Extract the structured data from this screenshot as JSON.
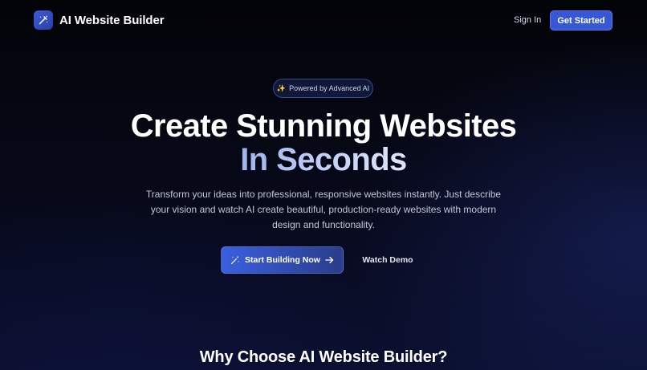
{
  "header": {
    "brand_name": "AI Website Builder",
    "logo_icon": "magic-wand-icon",
    "sign_in": "Sign In",
    "get_started": "Get Started"
  },
  "badge": {
    "icon": "sparkles-icon",
    "text": "Powered by Advanced AI"
  },
  "hero": {
    "title_line1": "Create Stunning Websites",
    "title_line2": "In Seconds",
    "subtitle": "Transform your ideas into professional, responsive websites instantly. Just describe your vision and watch AI create beautiful, production-ready websites with modern design and functionality."
  },
  "cta": {
    "primary_label": "Start Building Now",
    "primary_icon": "sparkles-icon",
    "primary_trailing_icon": "arrow-right-icon",
    "secondary_label": "Watch Demo"
  },
  "section": {
    "title": "Why Choose AI Website Builder?"
  },
  "colors": {
    "accent": "#3657d6",
    "background": "#05060f",
    "gradient_text": "#b8c6f2"
  }
}
